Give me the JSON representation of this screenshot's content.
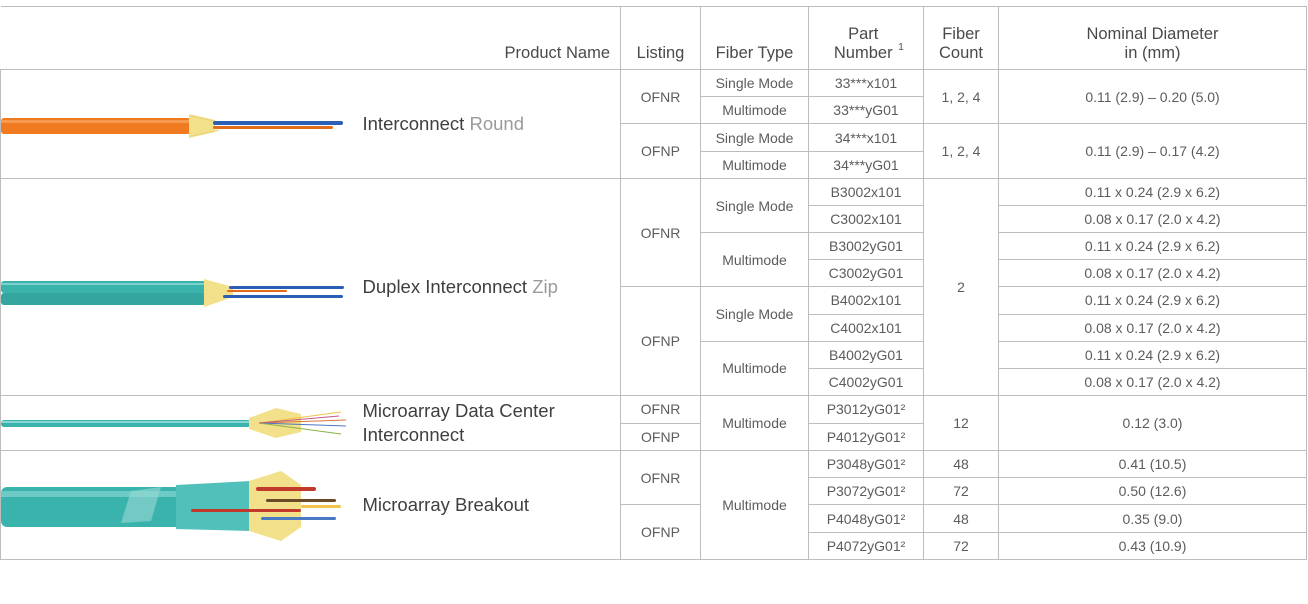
{
  "headers": {
    "product_name": "Product Name",
    "listing": "Listing",
    "fiber_type": "Fiber Type",
    "part_number": "Part Number",
    "part_number_sup": "1",
    "fiber_count": "Fiber Count",
    "diameter": "Nominal Diameter",
    "diameter_unit": "in (mm)"
  },
  "colors": {
    "border": "#bdbdbd",
    "orange_jacket": "#f07a20",
    "aqua_jacket": "#3bb3ad",
    "aramid_yarn": "#f3e08a"
  },
  "products": {
    "interconnect": {
      "name": "Interconnect",
      "sub": "Round",
      "image_icon": "orange-round-cable-image"
    },
    "duplex": {
      "name": "Duplex Interconnect",
      "sub": "Zip",
      "image_icon": "aqua-zip-cable-image"
    },
    "microarray_dc": {
      "name": "Microarray Data Center Interconnect",
      "image_icon": "aqua-microarray-cable-image"
    },
    "microarray_breakout": {
      "name": "Microarray Breakout",
      "image_icon": "aqua-breakout-cable-image"
    }
  },
  "cells": {
    "ofnr": "OFNR",
    "ofnp": "OFNP",
    "single_mode": "Single Mode",
    "multimode": "Multimode",
    "sup2": "²",
    "r1": {
      "pn": "33***x101",
      "count": "1, 2, 4",
      "dia": "0.11 (2.9) – 0.20 (5.0)"
    },
    "r2": {
      "pn": "33***yG01"
    },
    "r3": {
      "pn": "34***x101",
      "count": "1, 2, 4",
      "dia": "0.11 (2.9) – 0.17 (4.2)"
    },
    "r4": {
      "pn": "34***yG01"
    },
    "r5": {
      "pn": "B3002x101",
      "count": "2",
      "dia": "0.11 x 0.24 (2.9 x 6.2)"
    },
    "r6": {
      "pn": "C3002x101",
      "dia": "0.08 x 0.17 (2.0 x 4.2)"
    },
    "r7": {
      "pn": "B3002yG01",
      "dia": "0.11 x 0.24 (2.9 x 6.2)"
    },
    "r8": {
      "pn": "C3002yG01",
      "dia": "0.08 x 0.17 (2.0 x 4.2)"
    },
    "r9": {
      "pn": "B4002x101",
      "dia": "0.11 x 0.24 (2.9 x 6.2)"
    },
    "r10": {
      "pn": "C4002x101",
      "dia": "0.08 x 0.17 (2.0 x 4.2)"
    },
    "r11": {
      "pn": "B4002yG01",
      "dia": "0.11 x 0.24 (2.9 x 6.2)"
    },
    "r12": {
      "pn": "C4002yG01",
      "dia": "0.08 x 0.17 (2.0 x 4.2)"
    },
    "r13": {
      "pn": "P3012yG01",
      "count": "12",
      "dia": "0.12 (3.0)"
    },
    "r14": {
      "pn": "P4012yG01"
    },
    "r15": {
      "pn": "P3048yG01",
      "count": "48",
      "dia": "0.41 (10.5)"
    },
    "r16": {
      "pn": "P3072yG01",
      "count": "72",
      "dia": "0.50 (12.6)"
    },
    "r17": {
      "pn": "P4048yG01",
      "count": "48",
      "dia": "0.35 (9.0)"
    },
    "r18": {
      "pn": "P4072yG01",
      "count": "72",
      "dia": "0.43 (10.9)"
    }
  }
}
